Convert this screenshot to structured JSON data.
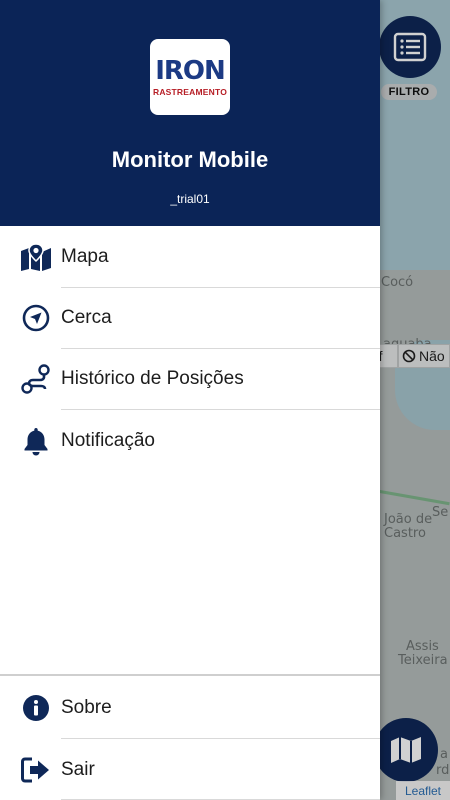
{
  "colors": {
    "header_bg": "#0b2457",
    "icon": "#0f2858",
    "fab_bg": "#0f2858"
  },
  "header": {
    "logo": {
      "word": "IRON",
      "sub": "RASTREAMENTO"
    },
    "title": "Monitor Mobile",
    "user": "_trial01"
  },
  "menu": {
    "items": [
      {
        "label": "Mapa",
        "icon": "map-icon"
      },
      {
        "label": "Cerca",
        "icon": "location-arrow-icon"
      },
      {
        "label": "Histórico de Posições",
        "icon": "route-icon"
      },
      {
        "label": "Notificação",
        "icon": "bell-icon"
      }
    ],
    "footer": [
      {
        "label": "Sobre",
        "icon": "info-icon"
      },
      {
        "label": "Sair",
        "icon": "sign-out-icon"
      }
    ]
  },
  "map": {
    "filter_label": "FILTRO",
    "attribution": "Leaflet",
    "chips": [
      "ff",
      "Não"
    ],
    "labels": [
      "Cocó",
      "aquaba",
      "Se",
      "João de",
      "Castro",
      "Assis",
      "Teixeira",
      "a",
      "rda"
    ]
  }
}
